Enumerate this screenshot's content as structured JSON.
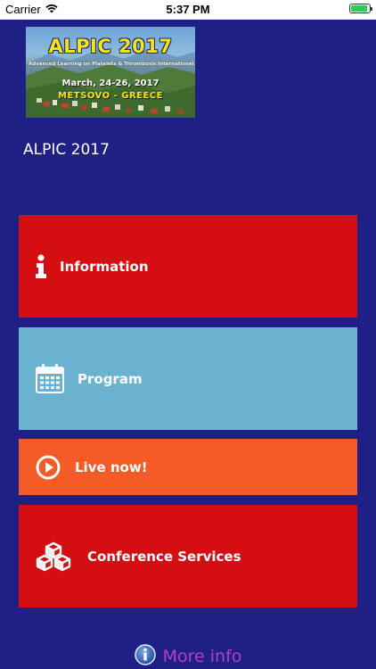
{
  "status_bar": {
    "carrier": "Carrier",
    "time": "5:37 PM",
    "battery_level": 0.9
  },
  "banner": {
    "title": "ALPIC 2017",
    "subtitle": "Advanced Learning on Platelets & Thrombosis International Course",
    "date": "March, 24-26, 2017",
    "location": "METSOVO - GREECE"
  },
  "app": {
    "title": "ALPIC 2017"
  },
  "menu": {
    "items": [
      {
        "label": "Information",
        "icon": "info-icon",
        "color": "#d50f11"
      },
      {
        "label": "Program",
        "icon": "calendar-icon",
        "color": "#6bb1d0"
      },
      {
        "label": "Live now!",
        "icon": "play-circle-icon",
        "color": "#f45b26"
      },
      {
        "label": "Conference Services",
        "icon": "cubes-icon",
        "color": "#d50f11"
      }
    ]
  },
  "footer": {
    "more_info_label": "More info",
    "icon": "info-circle-icon"
  },
  "colors": {
    "background": "#1f2085",
    "accent_purple": "#b040c4"
  }
}
